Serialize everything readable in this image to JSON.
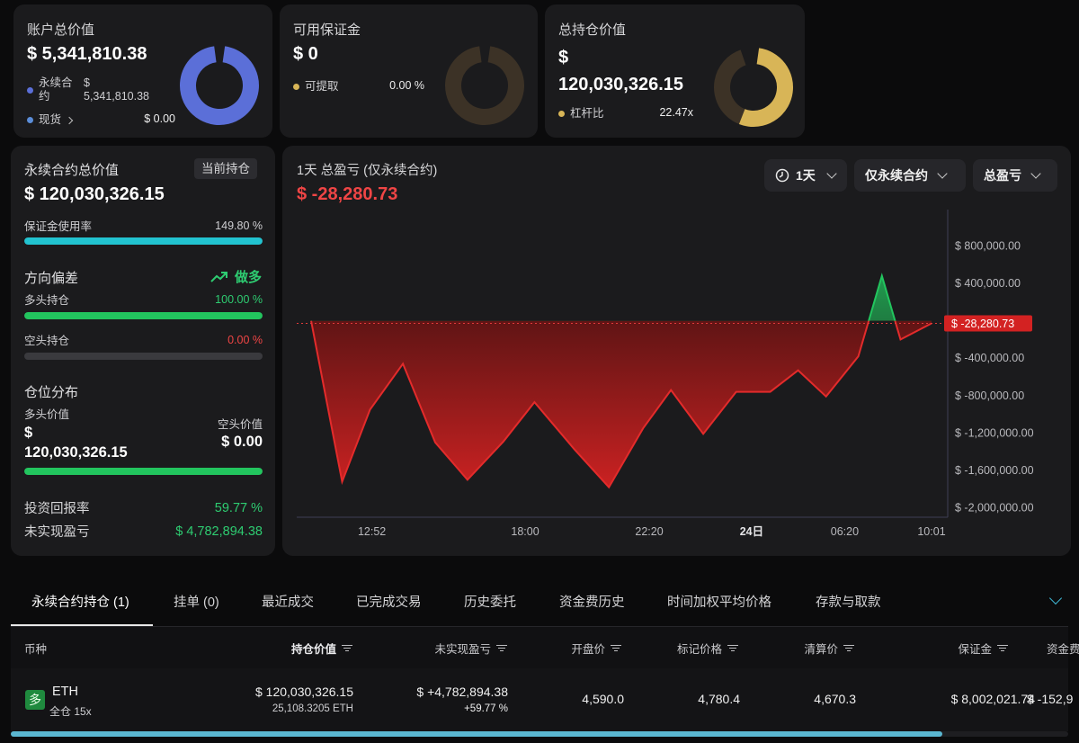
{
  "summary": {
    "account": {
      "title": "账户总价值",
      "value": "$ 5,341,810.38",
      "perp_label_1": "永续合",
      "perp_label_2": "约",
      "perp_value_1": "$",
      "perp_value_2": "5,341,810.38",
      "spot_label": "现货",
      "spot_value": "$ 0.00",
      "color": "#5b6fd8"
    },
    "margin": {
      "title": "可用保证金",
      "value": "$ 0",
      "withdraw_label": "可提取",
      "withdraw_value": "0.00 %",
      "color": "#d8b557"
    },
    "position": {
      "title": "总持仓价值",
      "value_1": "$",
      "value_2": "120,030,326.15",
      "leverage_label": "杠杆比",
      "leverage_value": "22.47x",
      "color": "#d8b557"
    }
  },
  "left_panel": {
    "title": "永续合约总价值",
    "badge": "当前持仓",
    "value": "$ 120,030,326.15",
    "margin_usage_label": "保证金使用率",
    "margin_usage_value": "149.80 %",
    "margin_usage_fill": 1.0,
    "bias_label": "方向偏差",
    "bias_value": "做多",
    "long_label": "多头持仓",
    "long_value": "100.00 %",
    "long_fill": 1.0,
    "short_label": "空头持仓",
    "short_value": "0.00 %",
    "short_fill": 0.0,
    "dist_label": "仓位分布",
    "long_val_label": "多头价值",
    "long_val_1": "$",
    "long_val_2": "120,030,326.15",
    "short_val_label": "空头价值",
    "short_val": "$ 0.00",
    "dist_fill": 1.0,
    "roi_label": "投资回报率",
    "roi_value": "59.77 %",
    "upnl_label": "未实现盈亏",
    "upnl_value": "$ 4,782,894.38"
  },
  "chart_panel": {
    "title": "1天 总盈亏 (仅永续合约)",
    "value": "$ -28,280.73",
    "period": "1天",
    "scope": "仅永续合约",
    "metric": "总盈亏",
    "current_tag": "$ -28,280.73"
  },
  "chart_data": {
    "type": "area",
    "y_ticks": [
      800000,
      400000,
      0,
      -400000,
      -800000,
      -1200000,
      -1600000,
      -2000000
    ],
    "y_tick_labels": [
      "$ 800,000.00",
      "$ 400,000.00",
      "",
      "$ -400,000.00",
      "$ -800,000.00",
      "$ -1,200,000.00",
      "$ -1,600,000.00",
      "$ -2,000,000.00"
    ],
    "x_tick_labels": [
      "12:52",
      "18:00",
      "22:20",
      "24日",
      "06:20",
      "10:01"
    ],
    "x_tick_t": [
      0.098,
      0.345,
      0.545,
      0.71,
      0.86,
      1.0
    ],
    "t": [
      0.0,
      0.05,
      0.095,
      0.148,
      0.2,
      0.252,
      0.31,
      0.36,
      0.425,
      0.48,
      0.535,
      0.58,
      0.632,
      0.685,
      0.74,
      0.785,
      0.83,
      0.882,
      0.92,
      0.95,
      1.0
    ],
    "y": [
      0,
      -1720000,
      -950000,
      -460000,
      -1300000,
      -1700000,
      -1290000,
      -870000,
      -1380000,
      -1780000,
      -1150000,
      -740000,
      -1210000,
      -760000,
      -760000,
      -530000,
      -810000,
      -380000,
      480000,
      -200000,
      -28280.73
    ],
    "ylim": [
      -2100000,
      1150000
    ],
    "current_value": -28280.73,
    "colors": {
      "loss": "#e32b2b",
      "gain": "#22c55e"
    }
  },
  "tabs": [
    {
      "label": "永续合约持仓 (1)",
      "active": true
    },
    {
      "label": "挂单 (0)"
    },
    {
      "label": "最近成交"
    },
    {
      "label": "已完成交易"
    },
    {
      "label": "历史委托"
    },
    {
      "label": "资金费历史"
    },
    {
      "label": "时间加权平均价格"
    },
    {
      "label": "存款与取款"
    }
  ],
  "table": {
    "headers": [
      "币种",
      "持仓价值",
      "未实现盈亏",
      "开盘价",
      "标记价格",
      "清算价",
      "保证金",
      "资金费"
    ],
    "rows": [
      {
        "side_badge": "多",
        "coin": "ETH",
        "mode": "全仓 15x",
        "position_value": "$ 120,030,326.15",
        "position_size": "25,108.3205 ETH",
        "upnl": "$ +4,782,894.38",
        "upnl_pct": "+59.77 %",
        "open_price": "4,590.0",
        "mark_price": "4,780.4",
        "liq_price": "4,670.3",
        "margin": "$ 8,002,021.74",
        "funding": "$ -152,9"
      }
    ]
  }
}
